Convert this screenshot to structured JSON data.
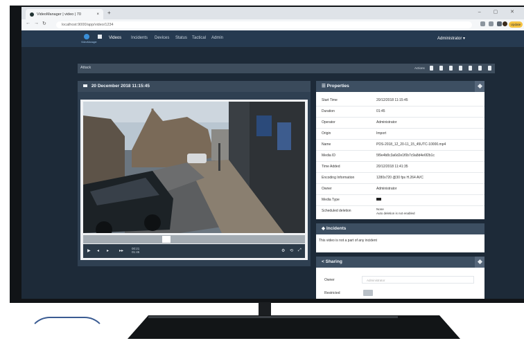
{
  "browser": {
    "tab_title": "VideoManager | video | 70",
    "url": "localhost:9000/app/video/1234",
    "update_label": "Update"
  },
  "nav": {
    "logo_text": "VideoManager",
    "items": [
      {
        "label": "Videos",
        "active": true
      },
      {
        "label": "Incidents",
        "active": false
      },
      {
        "label": "Devices",
        "active": false
      },
      {
        "label": "Status",
        "active": false
      },
      {
        "label": "Tactical",
        "active": false
      },
      {
        "label": "Admin",
        "active": false
      }
    ],
    "user": "Administrator"
  },
  "toolbar": {
    "label": "Attack",
    "actions_label": "Actions"
  },
  "video": {
    "title": "20 December 2018 11:15:45",
    "position": 0.37,
    "timecode_current": "00:21",
    "timecode_total": "01:45"
  },
  "properties": {
    "title": "Properties",
    "rows": [
      {
        "key": "Start Time",
        "value": "20/12/2018 11:15:45"
      },
      {
        "key": "Duration",
        "value": "01:45"
      },
      {
        "key": "Operator",
        "value": "Administrator"
      },
      {
        "key": "Origin",
        "value": "Import"
      },
      {
        "key": "Name",
        "value": "PDS-2018_12_20-11_15_45UTC-10000.mp4"
      },
      {
        "key": "Media ID",
        "value": "5f9e4b8c3a6d2e1f0b7c9a8d4e6f2b1c"
      },
      {
        "key": "Time Added",
        "value": "20/12/2018 11:41:35"
      },
      {
        "key": "Encoding Information",
        "value": "1280x720 @30 fps H.264 AVC"
      },
      {
        "key": "Owner",
        "value": "Administrator"
      },
      {
        "key": "Media Type",
        "value": ""
      },
      {
        "key": "Scheduled deletion",
        "value": "None\nAuto deletion is not enabled"
      }
    ]
  },
  "incidents": {
    "title": "Incidents",
    "message": "This video is not a part of any incident"
  },
  "sharing": {
    "title": "Sharing",
    "owner_label": "Owner",
    "owner_value": "Administrator",
    "restricted_label": "Restricted"
  },
  "colors": {
    "app_bg": "#1d2a38",
    "navbar": "#263a50",
    "panel_header": "#3d4f62",
    "accent": "#3a8fd8"
  }
}
